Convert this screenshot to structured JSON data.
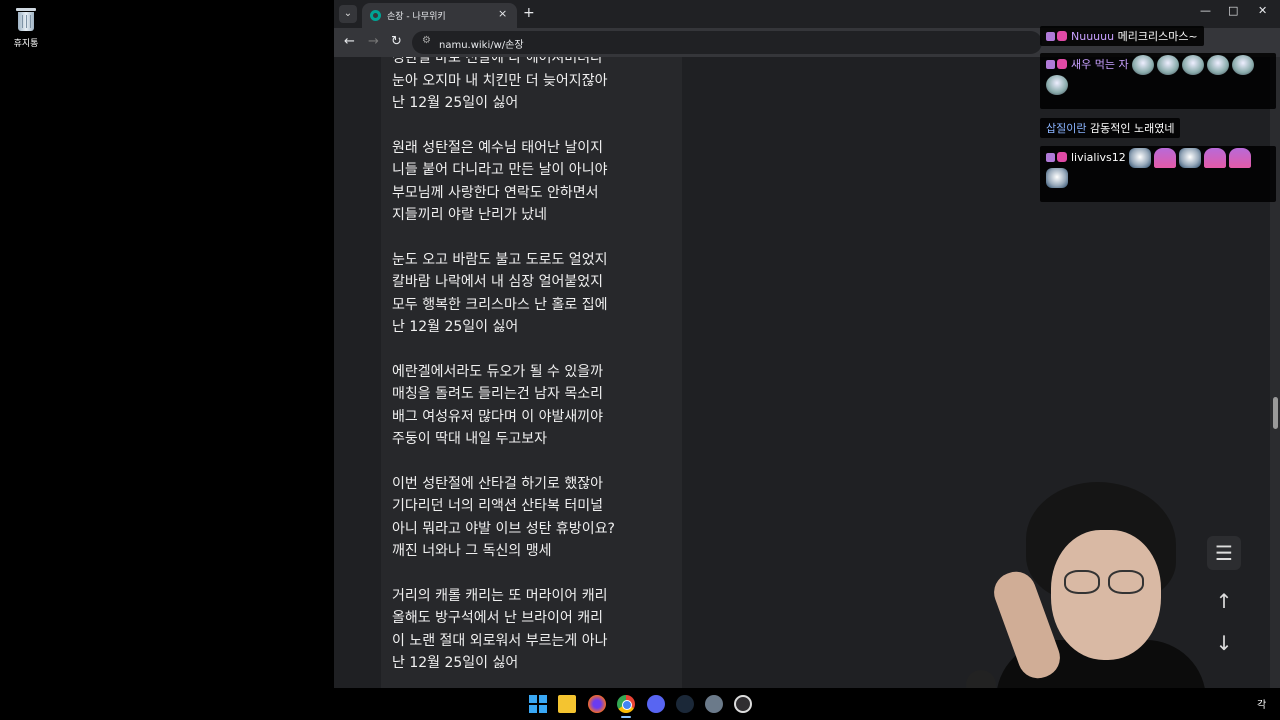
{
  "desktop": {
    "recycle_bin_label": "휴지통"
  },
  "browser": {
    "tab_title": "손장 - 나무위키",
    "tab_close": "×",
    "new_tab": "+",
    "url": "namu.wiki/w/손장",
    "window_controls": {
      "minimize": "—",
      "maximize": "□",
      "close": "✕"
    },
    "nav": {
      "back": "←",
      "forward": "→",
      "reload": "↻"
    }
  },
  "lyrics": {
    "stanzas": [
      [
        "성탄절 바로 전날에 다 헤어져버려라",
        "눈아 오지마 내 치킨만 더 늦어지잖아",
        "난 12월 25일이 싫어"
      ],
      [
        "원래 성탄절은 예수님 태어난 날이지",
        "니들 붙어 다니라고 만든 날이 아니야",
        "부모님께 사랑한다 연락도 안하면서",
        "지들끼리 야랄 난리가 났네"
      ],
      [
        "눈도 오고 바람도 불고 도로도 얼었지",
        "칼바람 나락에서 내 심장 얼어붙었지",
        "모두 행복한 크리스마스 난 홀로 집에",
        "난 12월 25일이 싫어"
      ],
      [
        "에란겔에서라도 듀오가 될 수 있을까",
        "매칭을 돌려도 들리는건 남자 목소리",
        "배그 여성유저 많다며 이 야발새끼야",
        "주둥이 딱대 내일 두고보자"
      ],
      [
        "이번 성탄절에 산타걸 하기로 했잖아",
        "기다리던 너의 리액션 산타복 터미널",
        "아니 뭐라고 야발 이브 성탄 휴방이요?",
        "깨진 너와나 그 독신의 맹세"
      ],
      [
        "거리의 캐롤 캐리는 또 머라이어 캐리",
        "올해도 방구석에서 난 브라이어 캐리",
        "이 노랜 절대 외로워서 부르는게 아나",
        "난 12월 25일이 싫어"
      ]
    ]
  },
  "floating_buttons": {
    "toc": "☰",
    "up": "↑",
    "down": "↓"
  },
  "chat": {
    "messages": [
      {
        "user": "Nuuuuu",
        "text": "메리크리스마스~"
      },
      {
        "user": "새우 먹는 자",
        "text": ""
      },
      {
        "user": "삽질이란",
        "text": "감동적인 노래였네"
      },
      {
        "user": "livialivs12",
        "text": ""
      }
    ]
  },
  "taskbar": {
    "apps": [
      "start",
      "file-explorer",
      "firefox",
      "chrome",
      "discord",
      "steam",
      "settings",
      "obs"
    ],
    "tray_text": "각"
  },
  "colors": {
    "accent": "#8ab4ff",
    "background": "#202124",
    "article": "#27282b"
  }
}
